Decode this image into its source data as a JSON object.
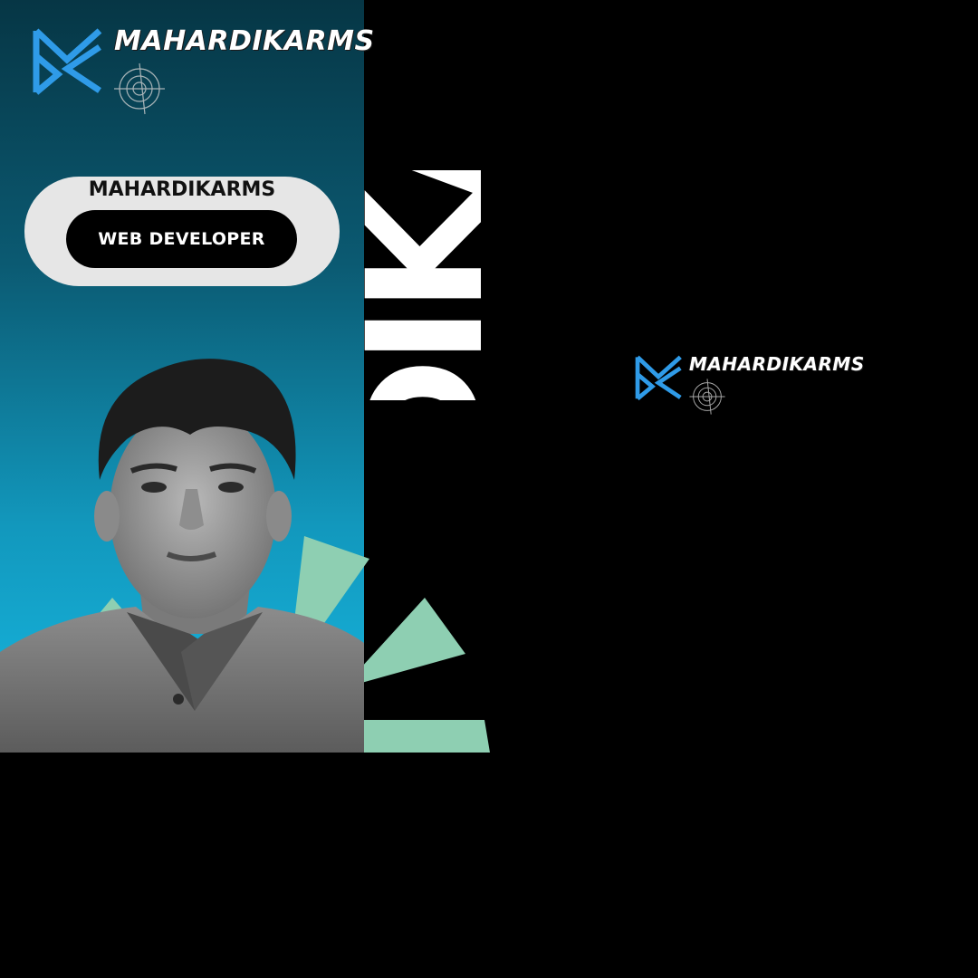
{
  "brand": {
    "wordmark": "MAHARDIKARMS",
    "mark_icon": "m-chevron-logo-icon",
    "target_icon": "crosshair-target-icon",
    "colors": {
      "mark": "#2f9be8",
      "wordmark": "#ffffff"
    }
  },
  "profile": {
    "name": "MAHARDIKARMS",
    "role": "WEB DEVELOPER",
    "big_name": "DIKA"
  },
  "theme": {
    "panel_gradient": [
      "#063645",
      "#17b8e2"
    ],
    "accent": "#8ecfb2",
    "background": "#000000",
    "card": "#e6e6e6"
  }
}
